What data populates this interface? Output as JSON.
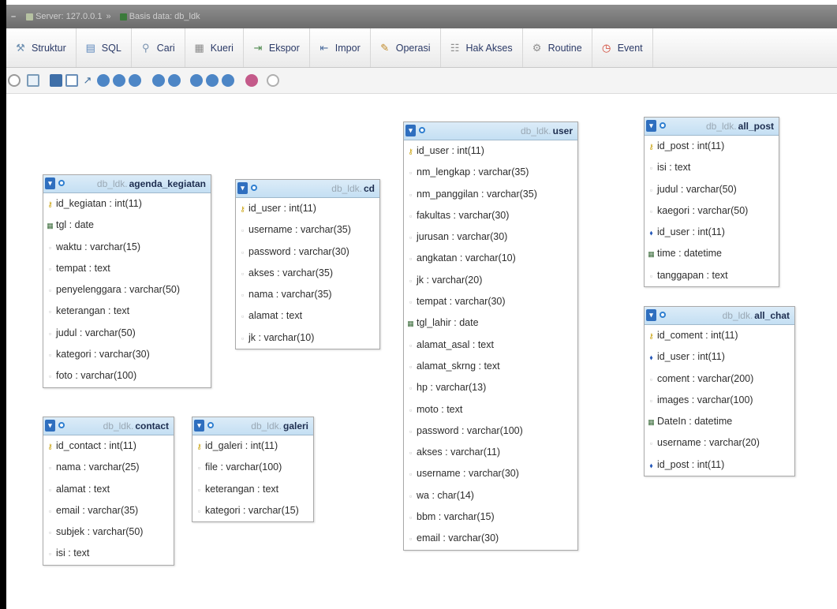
{
  "titlebar": {
    "server": "Server: 127.0.0.1",
    "separator": "»",
    "database": "Basis data: db_ldk",
    "collapse_label": "–"
  },
  "tabs": [
    {
      "label": "Struktur",
      "icon": "structure-icon"
    },
    {
      "label": "SQL",
      "icon": "sql-icon"
    },
    {
      "label": "Cari",
      "icon": "search-icon"
    },
    {
      "label": "Kueri",
      "icon": "query-icon"
    },
    {
      "label": "Ekspor",
      "icon": "export-icon"
    },
    {
      "label": "Impor",
      "icon": "import-icon"
    },
    {
      "label": "Operasi",
      "icon": "wrench-icon"
    },
    {
      "label": "Hak Akses",
      "icon": "privileges-icon"
    },
    {
      "label": "Routine",
      "icon": "routine-icon"
    },
    {
      "label": "Event",
      "icon": "event-icon"
    }
  ],
  "tables": [
    {
      "db": "db_ldk.",
      "name": "agenda_kegiatan",
      "columns": [
        {
          "text": "id_kegiatan : int(11)",
          "kind": "key"
        },
        {
          "text": "tgl : date",
          "kind": "dt"
        },
        {
          "text": "waktu : varchar(15)",
          "kind": "nrm"
        },
        {
          "text": "tempat : text",
          "kind": "nrm"
        },
        {
          "text": "penyelenggara : varchar(50)",
          "kind": "nrm"
        },
        {
          "text": "keterangan : text",
          "kind": "nrm"
        },
        {
          "text": "judul : varchar(50)",
          "kind": "nrm"
        },
        {
          "text": "kategori : varchar(30)",
          "kind": "nrm"
        },
        {
          "text": "foto : varchar(100)",
          "kind": "nrm"
        }
      ]
    },
    {
      "db": "db_ldk.",
      "name": "cd",
      "columns": [
        {
          "text": "id_user : int(11)",
          "kind": "key"
        },
        {
          "text": "username : varchar(35)",
          "kind": "nrm"
        },
        {
          "text": "password : varchar(30)",
          "kind": "nrm"
        },
        {
          "text": "akses : varchar(35)",
          "kind": "nrm"
        },
        {
          "text": "nama : varchar(35)",
          "kind": "nrm"
        },
        {
          "text": "alamat : text",
          "kind": "nrm"
        },
        {
          "text": "jk : varchar(10)",
          "kind": "nrm"
        }
      ]
    },
    {
      "db": "db_ldk.",
      "name": "user",
      "columns": [
        {
          "text": "id_user : int(11)",
          "kind": "key"
        },
        {
          "text": "nm_lengkap : varchar(35)",
          "kind": "nrm"
        },
        {
          "text": "nm_panggilan : varchar(35)",
          "kind": "nrm"
        },
        {
          "text": "fakultas : varchar(30)",
          "kind": "nrm"
        },
        {
          "text": "jurusan : varchar(30)",
          "kind": "nrm"
        },
        {
          "text": "angkatan : varchar(10)",
          "kind": "nrm"
        },
        {
          "text": "jk : varchar(20)",
          "kind": "nrm"
        },
        {
          "text": "tempat : varchar(30)",
          "kind": "nrm"
        },
        {
          "text": "tgl_lahir : date",
          "kind": "dt"
        },
        {
          "text": "alamat_asal : text",
          "kind": "nrm"
        },
        {
          "text": "alamat_skrng : text",
          "kind": "nrm"
        },
        {
          "text": "hp : varchar(13)",
          "kind": "nrm"
        },
        {
          "text": "moto : text",
          "kind": "nrm"
        },
        {
          "text": "password : varchar(100)",
          "kind": "nrm"
        },
        {
          "text": "akses : varchar(11)",
          "kind": "nrm"
        },
        {
          "text": "username : varchar(30)",
          "kind": "nrm"
        },
        {
          "text": "wa : char(14)",
          "kind": "nrm"
        },
        {
          "text": "bbm : varchar(15)",
          "kind": "nrm"
        },
        {
          "text": "email : varchar(30)",
          "kind": "nrm"
        }
      ]
    },
    {
      "db": "db_ldk.",
      "name": "all_post",
      "columns": [
        {
          "text": "id_post : int(11)",
          "kind": "key"
        },
        {
          "text": "isi : text",
          "kind": "nrm"
        },
        {
          "text": "judul : varchar(50)",
          "kind": "nrm"
        },
        {
          "text": "kaegori : varchar(50)",
          "kind": "nrm"
        },
        {
          "text": "id_user : int(11)",
          "kind": "fk"
        },
        {
          "text": "time : datetime",
          "kind": "dt"
        },
        {
          "text": "tanggapan : text",
          "kind": "nrm"
        }
      ]
    },
    {
      "db": "db_ldk.",
      "name": "all_chat",
      "columns": [
        {
          "text": "id_coment : int(11)",
          "kind": "key"
        },
        {
          "text": "id_user : int(11)",
          "kind": "fk"
        },
        {
          "text": "coment : varchar(200)",
          "kind": "nrm"
        },
        {
          "text": "images : varchar(100)",
          "kind": "nrm"
        },
        {
          "text": "DateIn : datetime",
          "kind": "dt"
        },
        {
          "text": "username : varchar(20)",
          "kind": "nrm"
        },
        {
          "text": "id_post : int(11)",
          "kind": "fk"
        }
      ]
    },
    {
      "db": "db_ldk.",
      "name": "contact",
      "columns": [
        {
          "text": "id_contact : int(11)",
          "kind": "key"
        },
        {
          "text": "nama : varchar(25)",
          "kind": "nrm"
        },
        {
          "text": "alamat : text",
          "kind": "nrm"
        },
        {
          "text": "email : varchar(35)",
          "kind": "nrm"
        },
        {
          "text": "subjek : varchar(50)",
          "kind": "nrm"
        },
        {
          "text": "isi : text",
          "kind": "nrm"
        }
      ]
    },
    {
      "db": "db_ldk.",
      "name": "galeri",
      "columns": [
        {
          "text": "id_galeri : int(11)",
          "kind": "key"
        },
        {
          "text": "file : varchar(100)",
          "kind": "nrm"
        },
        {
          "text": "keterangan : text",
          "kind": "nrm"
        },
        {
          "text": "kategori : varchar(15)",
          "kind": "nrm"
        }
      ]
    }
  ],
  "colors": {
    "header_gradient_top": "#dcecf8",
    "header_gradient_bottom": "#c4dff3",
    "tab_text": "#2b3a67",
    "titlebar": "#7a7a7a"
  }
}
